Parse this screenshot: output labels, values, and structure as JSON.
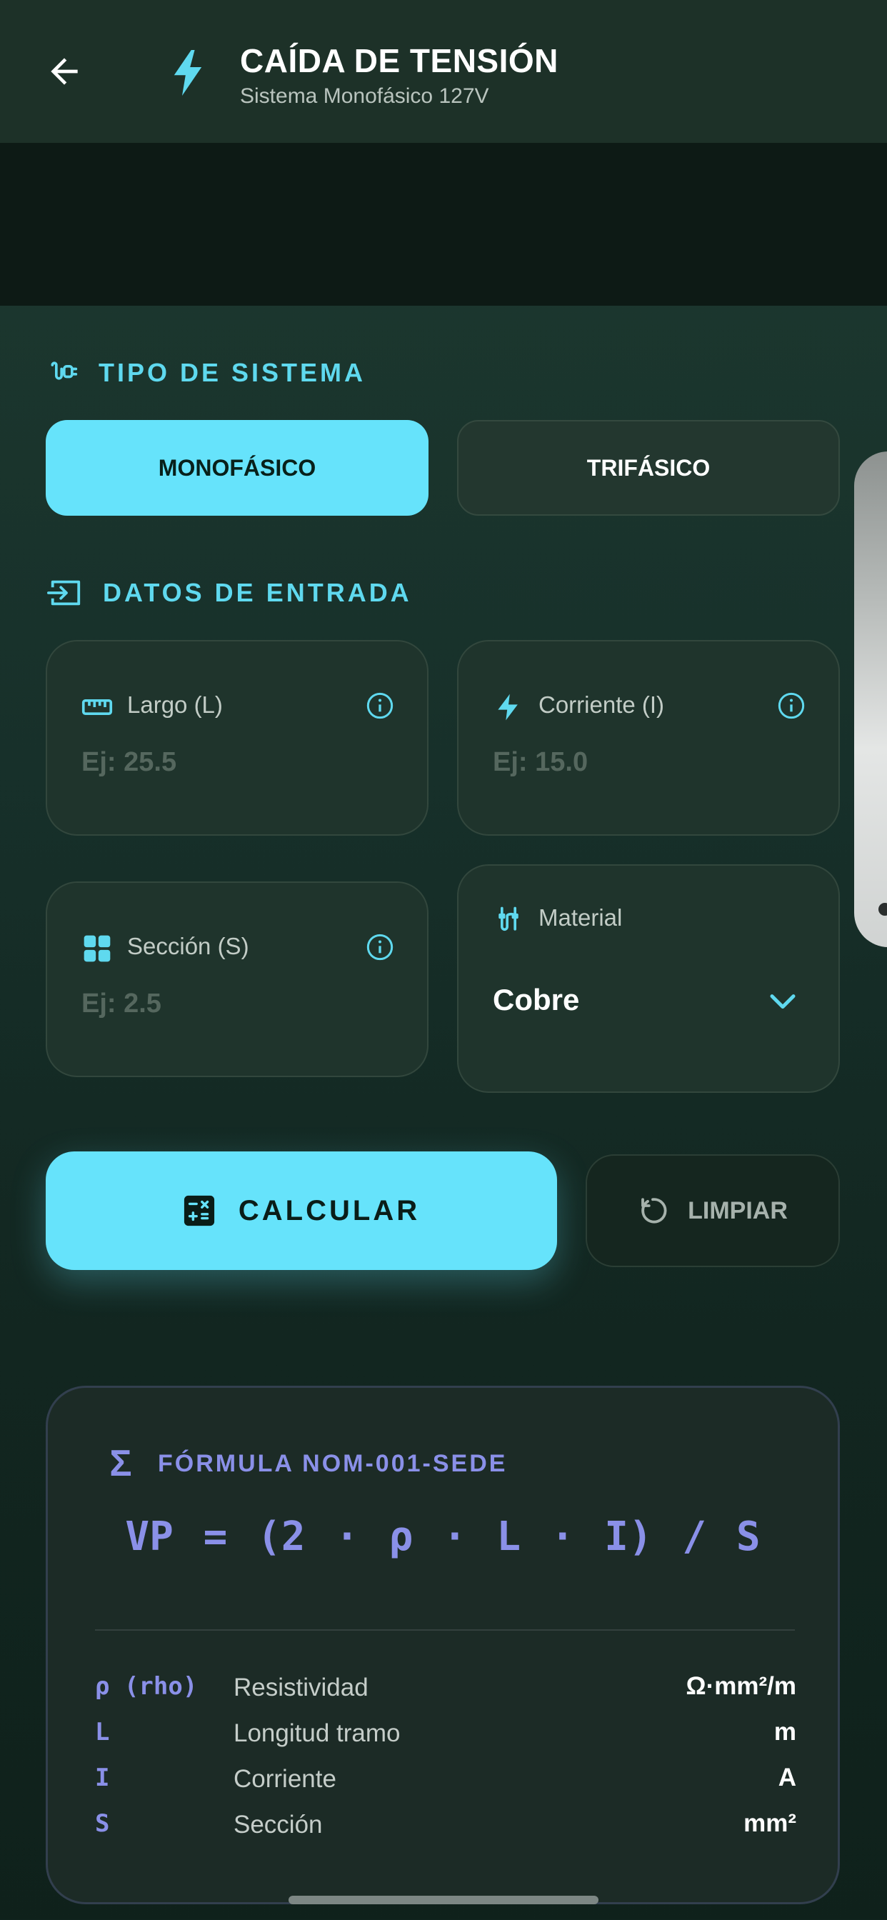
{
  "app_bar": {
    "title": "CAÍDA DE TENSIÓN",
    "subtitle": "Sistema Monofásico 127V"
  },
  "system_section": {
    "label": "TIPO DE SISTEMA",
    "options": [
      {
        "label": "MONOFÁSICO",
        "selected": true
      },
      {
        "label": "TRIFÁSICO",
        "selected": false
      }
    ]
  },
  "input_section": {
    "label": "DATOS DE ENTRADA",
    "length": {
      "label": "Largo (L)",
      "placeholder": "Ej: 25.5",
      "value": ""
    },
    "current": {
      "label": "Corriente (I)",
      "placeholder": "Ej: 15.0",
      "value": ""
    },
    "section": {
      "label": "Sección (S)",
      "placeholder": "Ej: 2.5",
      "value": ""
    },
    "material": {
      "label": "Material",
      "value": "Cobre"
    }
  },
  "actions": {
    "calculate": "CALCULAR",
    "clear": "LIMPIAR"
  },
  "formula": {
    "title": "FÓRMULA NOM-001-SEDE",
    "symbol": "Σ",
    "equation": "VP = (2 · ρ · L · I) / S",
    "variables": [
      {
        "symbol": "ρ (rho)",
        "name": "Resistividad",
        "unit": "Ω·mm²/m"
      },
      {
        "symbol": "L",
        "name": "Longitud tramo",
        "unit": "m"
      },
      {
        "symbol": "I",
        "name": "Corriente",
        "unit": "A"
      },
      {
        "symbol": "S",
        "name": "Sección",
        "unit": "mm²"
      }
    ]
  },
  "colors": {
    "accent": "#66e3fb",
    "formula_accent": "#8a90e8",
    "background": "#17302a",
    "app_bar": "#1d3128"
  },
  "icons": {
    "back": "arrow-left-icon",
    "app": "bolt-icon",
    "system": "plug-icon",
    "input": "login-icon",
    "length": "ruler-icon",
    "current": "bolt-icon",
    "section": "grid-icon",
    "material": "cable-icon",
    "info": "info-icon",
    "dropdown": "chevron-down-icon",
    "calculate": "calculator-icon",
    "clear": "refresh-icon",
    "formula": "sigma-icon"
  }
}
